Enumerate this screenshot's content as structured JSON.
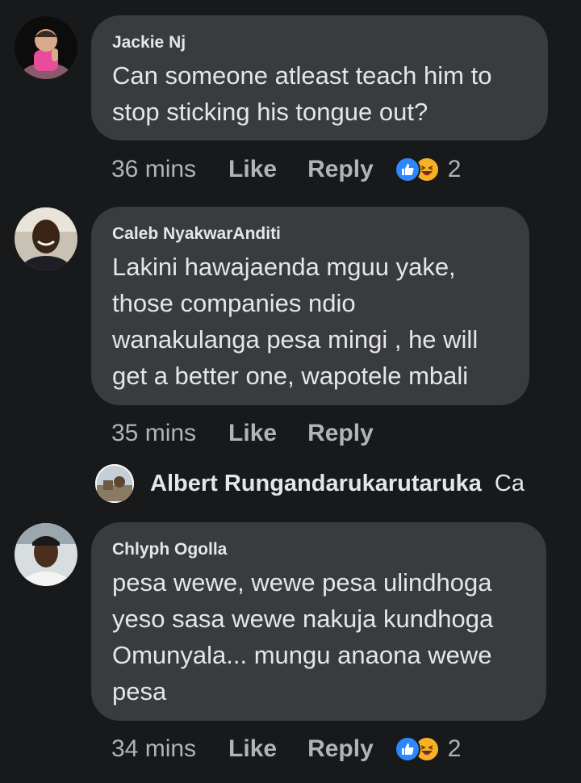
{
  "comments": [
    {
      "author": "Jackie Nj",
      "text": "Can someone atleast teach him to\nstop sticking his tongue out?",
      "time": "36 mins",
      "like": "Like",
      "reply": "Reply",
      "reaction_count": "2",
      "reactions": [
        "like-icon",
        "haha-icon"
      ]
    },
    {
      "author": "Caleb NyakwarAnditi",
      "text": "Lakini hawajaenda mguu yake,\nthose companies ndio\nwanakulanga pesa mingi , he will\nget a better one, wapotele mbali",
      "time": "35 mins",
      "like": "Like",
      "reply": "Reply"
    },
    {
      "author": "Chlyph Ogolla",
      "text": "pesa wewe, wewe pesa ulindhoga\nyeso sasa wewe nakuja kundhoga\nOmunyala... mungu anaona wewe\npesa",
      "time": "34 mins",
      "like": "Like",
      "reply": "Reply",
      "reaction_count": "2",
      "reactions": [
        "like-icon",
        "haha-icon"
      ]
    }
  ],
  "reply_preview": {
    "author": "Albert Rungandarukarutaruka",
    "snippet": "Ca"
  },
  "colors": {
    "background": "#18191a",
    "bubble": "#3a3b3c",
    "text": "#e4e6eb",
    "meta": "#b0b3b8",
    "like_blue": "#2d88ff",
    "haha_yellow": "#f7b125"
  }
}
